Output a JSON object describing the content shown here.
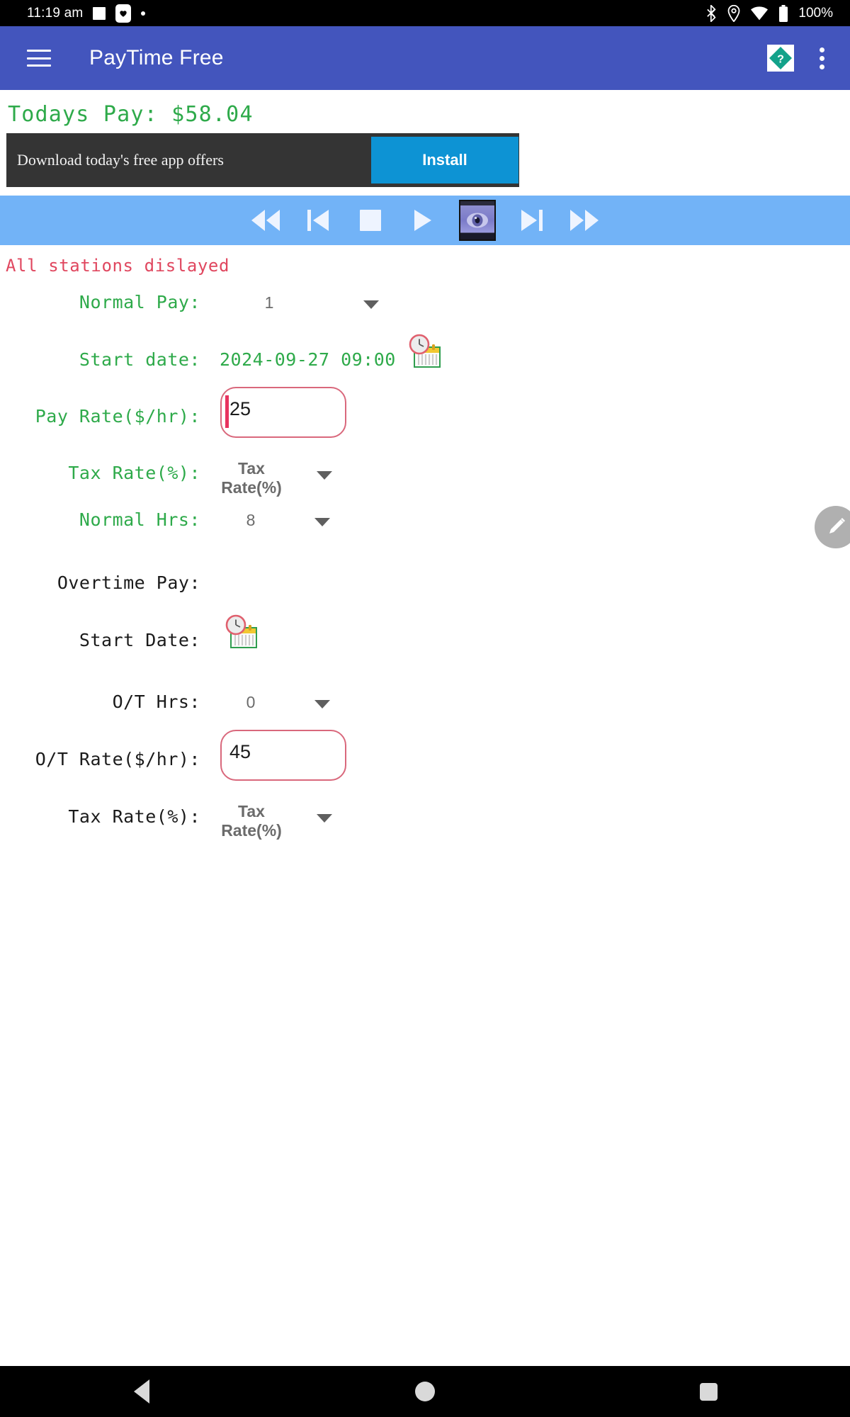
{
  "status_bar": {
    "time": "11:19 am",
    "left_icons": [
      "square-icon",
      "heart-badge-icon",
      "dot-icon"
    ],
    "right_icons": [
      "bluetooth-icon",
      "location-icon",
      "wifi-icon",
      "battery-icon"
    ],
    "battery_percent": "100%"
  },
  "app_bar": {
    "menu_icon": "hamburger-icon",
    "title": "PayTime Free",
    "help_icon": "help-diamond-icon",
    "overflow_icon": "kebab-menu-icon",
    "background_color": "#4355bd"
  },
  "summary": {
    "todays_pay": "Todays Pay: $58.04",
    "color": "#2eaa4a"
  },
  "ad": {
    "text": "Download today's free app offers",
    "install_label": "Install",
    "install_color": "#0d93d4",
    "background_color": "#343434"
  },
  "media_bar": {
    "background_color": "#72b3f7",
    "buttons": [
      {
        "name": "rewind-icon",
        "label": "Rewind"
      },
      {
        "name": "previous-icon",
        "label": "Previous"
      },
      {
        "name": "stop-icon",
        "label": "Stop"
      },
      {
        "name": "play-icon",
        "label": "Play"
      },
      {
        "name": "eye-icon",
        "label": "View"
      },
      {
        "name": "next-icon",
        "label": "Next"
      },
      {
        "name": "fast-forward-icon",
        "label": "Fast forward"
      }
    ]
  },
  "status_message": {
    "text": "All stations dislayed",
    "color": "#e0475f"
  },
  "normal_pay": {
    "section_rows": [
      {
        "key": "normal_pay_count",
        "label": "Normal Pay:",
        "type": "spinner",
        "value": "1",
        "label_color": "green"
      },
      {
        "key": "start_date",
        "label": "Start date:",
        "type": "date",
        "value": "2024-09-27 09:00",
        "icon": "calendar-clock-icon",
        "label_color": "green"
      },
      {
        "key": "pay_rate",
        "label": "Pay Rate($/hr):",
        "type": "textbox",
        "value": "25",
        "label_color": "green"
      },
      {
        "key": "tax_rate_normal",
        "label": "Tax Rate(%):",
        "type": "spinner",
        "value": "Tax Rate(%)",
        "label_color": "green"
      },
      {
        "key": "normal_hrs",
        "label": "Normal Hrs:",
        "type": "spinner",
        "value": "8",
        "label_color": "green"
      }
    ]
  },
  "overtime_pay": {
    "heading": "Overtime Pay:",
    "section_rows": [
      {
        "key": "ot_start_date",
        "label": "Start Date:",
        "type": "date",
        "value": "",
        "icon": "calendar-clock-icon",
        "label_color": "black"
      },
      {
        "key": "ot_hrs",
        "label": "O/T Hrs:",
        "type": "spinner",
        "value": "0",
        "label_color": "black"
      },
      {
        "key": "ot_rate",
        "label": "O/T Rate($/hr):",
        "type": "textbox",
        "value": "45",
        "label_color": "black"
      },
      {
        "key": "tax_rate_ot",
        "label": "Tax Rate(%):",
        "type": "spinner",
        "value": "Tax Rate(%)",
        "label_color": "black"
      }
    ]
  },
  "fab": {
    "icon": "pencil-icon",
    "color": "#b0b0b0"
  },
  "nav_bar": {
    "back": "back-icon",
    "home": "home-icon",
    "recents": "recents-icon"
  }
}
